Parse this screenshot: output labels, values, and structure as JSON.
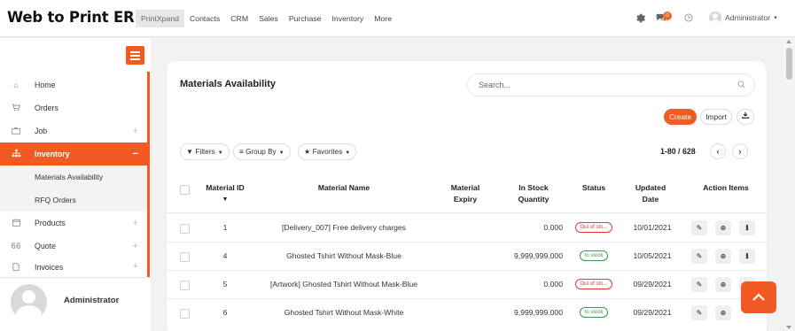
{
  "app": {
    "title": "Web to Print ERP"
  },
  "top_menu": [
    "PrintXpand",
    "Contacts",
    "CRM",
    "Sales",
    "Purchase",
    "Inventory",
    "More"
  ],
  "topbar": {
    "notification_count": "0",
    "user_name": "Administrator",
    "user_caret": "▾"
  },
  "sidebar": {
    "items": [
      {
        "label": "Home",
        "icon": "home-icon"
      },
      {
        "label": "Orders",
        "icon": "cart-icon"
      },
      {
        "label": "Job",
        "icon": "briefcase-icon",
        "expand": "+"
      },
      {
        "label": "Inventory",
        "icon": "sitemap-icon",
        "expand": "−"
      },
      {
        "label": "Products",
        "icon": "calendar-icon",
        "expand": "+"
      },
      {
        "label": "Quote",
        "icon": "quote-icon",
        "expand": "+"
      },
      {
        "label": "Invoices",
        "icon": "file-icon",
        "expand": "+"
      }
    ],
    "sub_items": [
      "Materials Availability",
      "RFQ Orders"
    ],
    "footer_user": "Administrator"
  },
  "main": {
    "title": "Materials Availability",
    "search_placeholder": "Search...",
    "create_label": "Create",
    "import_label": "Import",
    "filters_label": "Filters",
    "groupby_label": "Group By",
    "favorites_label": "Favorites",
    "pager": "1-80 / 628",
    "prev": "‹",
    "next": "›"
  },
  "table": {
    "headers": {
      "material_id": "Material ID",
      "material_name": "Material Name",
      "material_expiry": [
        "Material",
        "Expiry"
      ],
      "in_stock": [
        "In Stock",
        "Quantity"
      ],
      "status": "Status",
      "updated": [
        "Updated",
        "Date"
      ],
      "actions": "Action Items",
      "sort_indicator": "▼"
    },
    "rows": [
      {
        "id": "1",
        "name": "[Delivery_007] Free delivery charges",
        "qty": "0.000",
        "status": "Out of sto...",
        "status_type": "out",
        "date": "10/01/2021"
      },
      {
        "id": "4",
        "name": "Ghosted Tshirt Without Mask-Blue",
        "qty": "9,999,999.000",
        "status": "In stock",
        "status_type": "in",
        "date": "10/05/2021"
      },
      {
        "id": "5",
        "name": "[Artwork] Ghosted Tshirt Without Mask-Blue",
        "qty": "0.000",
        "status": "Out of sto...",
        "status_type": "out",
        "date": "09/29/2021"
      },
      {
        "id": "6",
        "name": "Ghosted Tshirt Without Mask-White",
        "qty": "9,999,999.000",
        "status": "In stock",
        "status_type": "in",
        "date": "09/29/2021"
      }
    ]
  },
  "colors": {
    "accent": "#f15a22",
    "out_of_stock": "#e53935",
    "in_stock": "#2e9e4f"
  }
}
